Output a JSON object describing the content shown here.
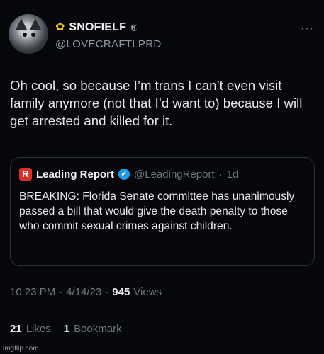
{
  "author": {
    "display_name": "SNOFIELF",
    "handle": "@LOVECRAFTLPRD",
    "name_emoji_icon": "sunflower-icon",
    "name_glyph": "𝕮"
  },
  "tweet": {
    "text": "Oh cool, so because I’m trans I can’t even visit family anymore (not that I’d want to) because I will get arrested and killed for it."
  },
  "quote": {
    "logo_letter": "R",
    "name": "Leading Report",
    "handle": "@LeadingReport",
    "separator": "·",
    "age": "1d",
    "text": "BREAKING: Florida Senate committee has unanimously passed a bill that would give the death penalty to those who commit sexual crimes against children."
  },
  "meta": {
    "time": "10:23 PM",
    "sep1": "·",
    "date": "4/14/23",
    "sep2": "·",
    "views_count": "945",
    "views_label": "Views"
  },
  "stats": {
    "likes_count": "21",
    "likes_label": "Likes",
    "bookmarks_count": "1",
    "bookmarks_label": "Bookmark"
  },
  "menu": {
    "more_glyph": "···"
  },
  "watermark": "imgflip.com",
  "colors": {
    "background": "#06070a",
    "text": "#e7e9ea",
    "muted": "#71767b",
    "verified": "#1d9bf0",
    "logo_red": "#d9312b",
    "sunflower": "#f3c21d"
  }
}
